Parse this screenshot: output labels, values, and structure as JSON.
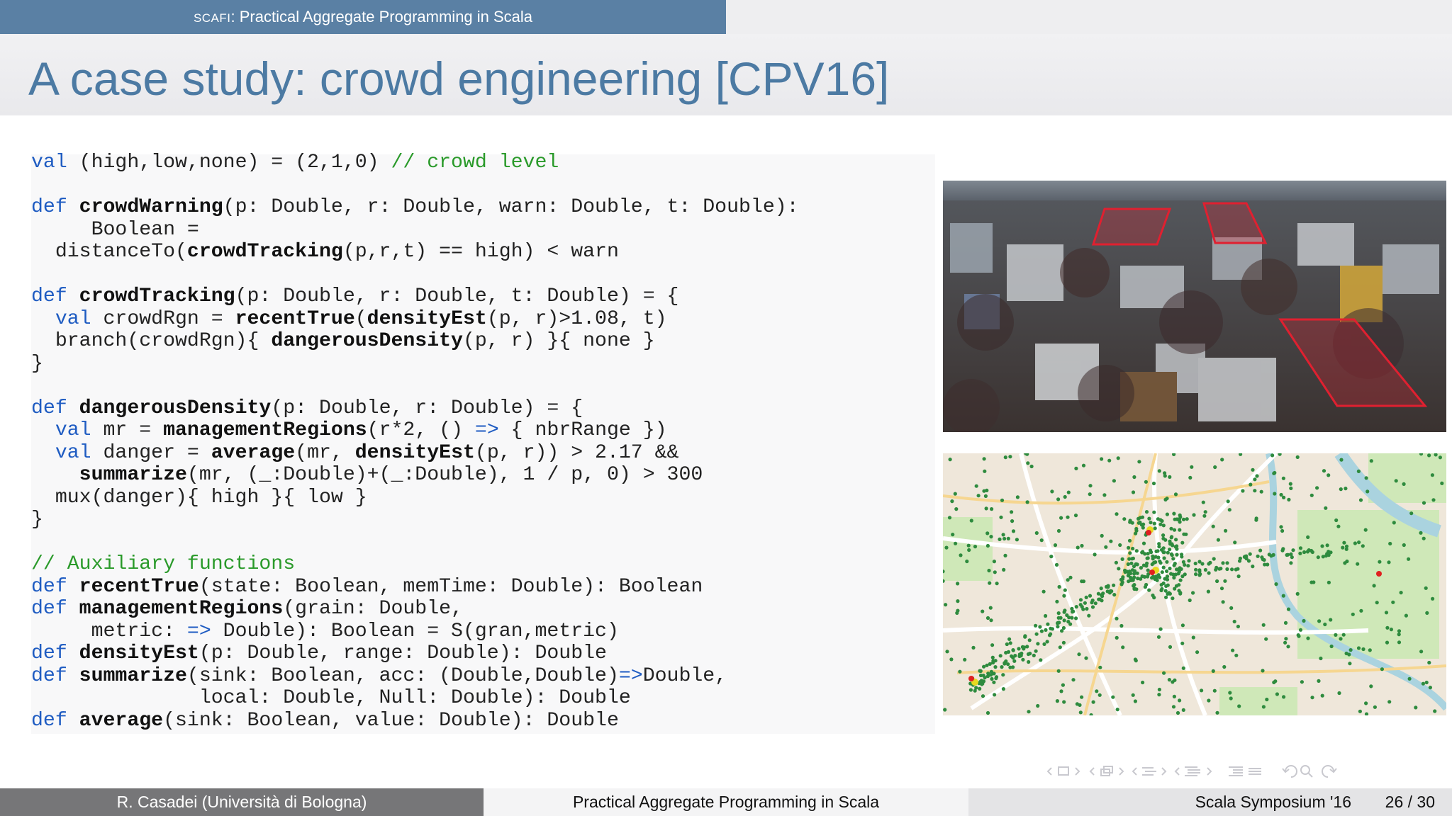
{
  "header": {
    "tab_prefix": "SCAFI",
    "tab_rest": ": Practical Aggregate Programming in Scala"
  },
  "slide": {
    "title": "A case study: crowd engineering [CPV16]"
  },
  "code": {
    "lines": [
      [
        [
          "kw",
          "val"
        ],
        [
          "t",
          " (high,low,none) = (2,1,0) "
        ],
        [
          "cm",
          "// crowd level"
        ]
      ],
      [],
      [
        [
          "kw",
          "def"
        ],
        [
          "t",
          " "
        ],
        [
          "b",
          "crowdWarning"
        ],
        [
          "t",
          "(p: Double, r: Double, warn: Double, t: Double):"
        ]
      ],
      [
        [
          "t",
          "     Boolean ="
        ]
      ],
      [
        [
          "t",
          "  distanceTo("
        ],
        [
          "b",
          "crowdTracking"
        ],
        [
          "t",
          "(p,r,t) == high) < warn"
        ]
      ],
      [],
      [
        [
          "kw",
          "def"
        ],
        [
          "t",
          " "
        ],
        [
          "b",
          "crowdTracking"
        ],
        [
          "t",
          "(p: Double, r: Double, t: Double) = {"
        ]
      ],
      [
        [
          "t",
          "  "
        ],
        [
          "kw",
          "val"
        ],
        [
          "t",
          " crowdRgn = "
        ],
        [
          "b",
          "recentTrue"
        ],
        [
          "t",
          "("
        ],
        [
          "b",
          "densityEst"
        ],
        [
          "t",
          "(p, r)>1.08, t)"
        ]
      ],
      [
        [
          "t",
          "  branch(crowdRgn){ "
        ],
        [
          "b",
          "dangerousDensity"
        ],
        [
          "t",
          "(p, r) }{ none }"
        ]
      ],
      [
        [
          "t",
          "}"
        ]
      ],
      [],
      [
        [
          "kw",
          "def"
        ],
        [
          "t",
          " "
        ],
        [
          "b",
          "dangerousDensity"
        ],
        [
          "t",
          "(p: Double, r: Double) = {"
        ]
      ],
      [
        [
          "t",
          "  "
        ],
        [
          "kw",
          "val"
        ],
        [
          "t",
          " mr = "
        ],
        [
          "b",
          "managementRegions"
        ],
        [
          "t",
          "(r*2, () "
        ],
        [
          "kw",
          "=>"
        ],
        [
          "t",
          " { nbrRange })"
        ]
      ],
      [
        [
          "t",
          "  "
        ],
        [
          "kw",
          "val"
        ],
        [
          "t",
          " danger = "
        ],
        [
          "b",
          "average"
        ],
        [
          "t",
          "(mr, "
        ],
        [
          "b",
          "densityEst"
        ],
        [
          "t",
          "(p, r)) > 2.17 &&"
        ]
      ],
      [
        [
          "t",
          "    "
        ],
        [
          "b",
          "summarize"
        ],
        [
          "t",
          "(mr, (_:Double)+(_:Double), 1 / p, 0) > 300"
        ]
      ],
      [
        [
          "t",
          "  mux(danger){ high }{ low }"
        ]
      ],
      [
        [
          "t",
          "}"
        ]
      ],
      [],
      [
        [
          "cm",
          "// Auxiliary functions"
        ]
      ],
      [
        [
          "kw",
          "def"
        ],
        [
          "t",
          " "
        ],
        [
          "b",
          "recentTrue"
        ],
        [
          "t",
          "(state: Boolean, memTime: Double): Boolean"
        ]
      ],
      [
        [
          "kw",
          "def"
        ],
        [
          "t",
          " "
        ],
        [
          "b",
          "managementRegions"
        ],
        [
          "t",
          "(grain: Double,"
        ]
      ],
      [
        [
          "t",
          "     metric: "
        ],
        [
          "kw",
          "=>"
        ],
        [
          "t",
          " Double): Boolean = S(gran,metric)"
        ]
      ],
      [
        [
          "kw",
          "def"
        ],
        [
          "t",
          " "
        ],
        [
          "b",
          "densityEst"
        ],
        [
          "t",
          "(p: Double, range: Double): Double"
        ]
      ],
      [
        [
          "kw",
          "def"
        ],
        [
          "t",
          " "
        ],
        [
          "b",
          "summarize"
        ],
        [
          "t",
          "(sink: Boolean, acc: (Double,Double)"
        ],
        [
          "kw",
          "=>"
        ],
        [
          "t",
          "Double,"
        ]
      ],
      [
        [
          "t",
          "              local: Double, Null: Double): Double"
        ]
      ],
      [
        [
          "kw",
          "def"
        ],
        [
          "t",
          " "
        ],
        [
          "b",
          "average"
        ],
        [
          "t",
          "(sink: Boolean, value: Double): Double"
        ]
      ]
    ]
  },
  "footer": {
    "author": "R. Casadei  (Università di Bologna)",
    "talk": "Practical Aggregate Programming in Scala",
    "venue": "Scala Symposium '16",
    "page": "26 / 30"
  },
  "icons": [
    "nav-frame-icon",
    "nav-subsection-icon",
    "nav-section-icon",
    "nav-slide-icon",
    "nav-align-icon",
    "nav-undo-icon",
    "search-icon",
    "nav-redo-icon"
  ],
  "colors": {
    "header_blue": "#5a80a4",
    "title_blue": "#4c7aa3",
    "keyword_blue": "#1f5cc2",
    "comment_green": "#2a9a2a",
    "region_red": "#e02030"
  }
}
